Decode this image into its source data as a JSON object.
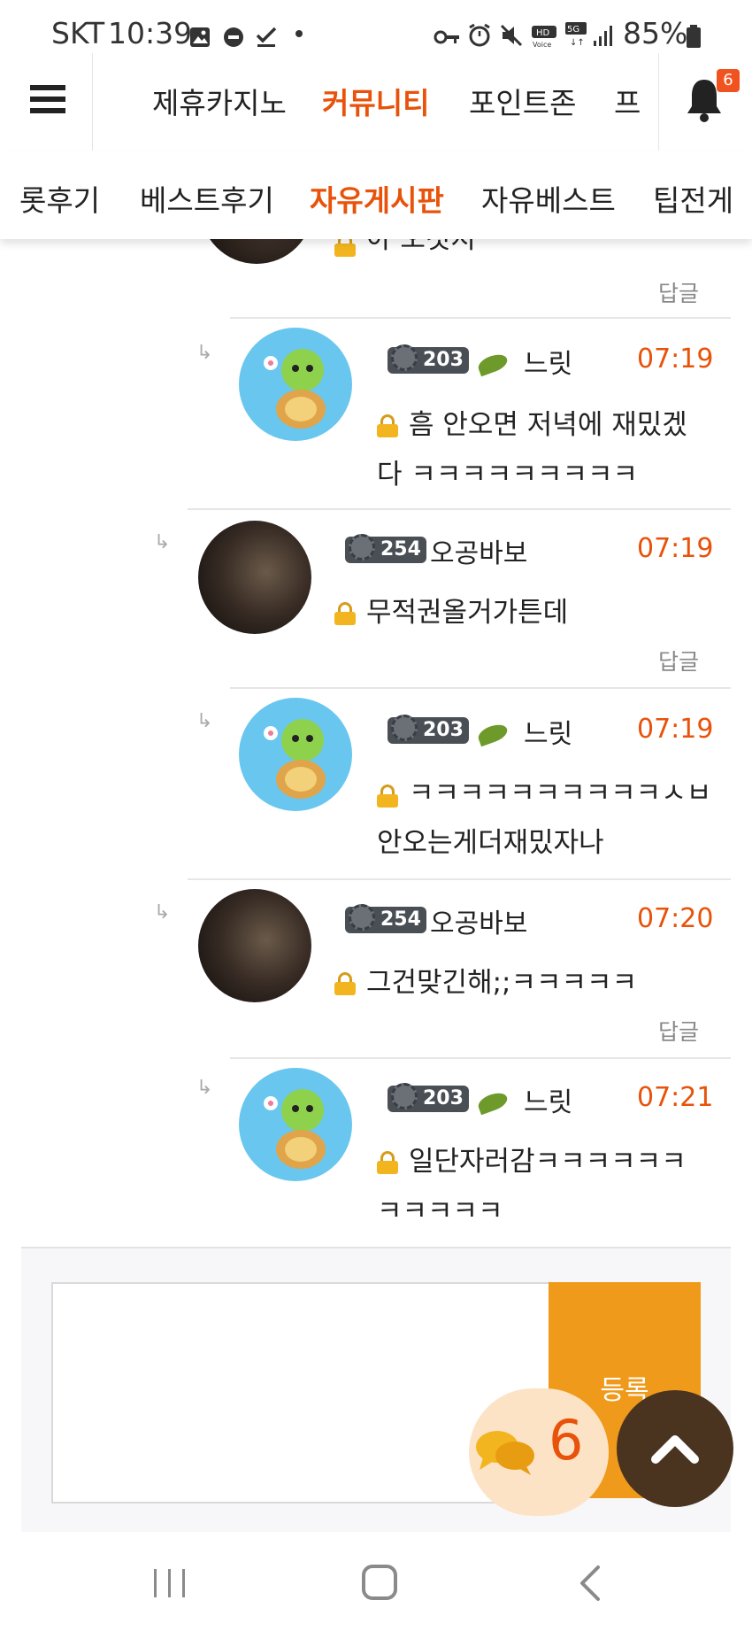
{
  "status_bar": {
    "carrier": "SKT",
    "time": "10:39",
    "battery": "85%"
  },
  "top_nav": {
    "items": [
      "제휴카지노",
      "커뮤니티",
      "포인트존",
      "프"
    ],
    "active": "커뮤니티",
    "notification_count": "6"
  },
  "sub_nav": {
    "items": [
      "롯후기",
      "베스트후기",
      "자유게시판",
      "자유베스트",
      "팁전게"
    ],
    "active": "자유게시판"
  },
  "partial_top_comment": {
    "text": "아 오것지",
    "reply_label": "답글"
  },
  "comments": [
    {
      "user": "느릿",
      "level": "203",
      "time": "07:19",
      "line1": "흠 안오면 저녁에 재밌겠",
      "line2": "다 ㅋㅋㅋㅋㅋㅋㅋㅋㅋ",
      "reply": ""
    },
    {
      "user": "오공바보",
      "level": "254",
      "time": "07:19",
      "line1": "무적권올거가튼데",
      "line2": "",
      "reply": "답글"
    },
    {
      "user": "느릿",
      "level": "203",
      "time": "07:19",
      "line1": "ㅋㅋㅋㅋㅋㅋㅋㅋㅋㅋㅅㅂ",
      "line2": "안오는게더재밌자나",
      "reply": ""
    },
    {
      "user": "오공바보",
      "level": "254",
      "time": "07:20",
      "line1": "그건맞긴해;;ㅋㅋㅋㅋㅋ",
      "line2": "",
      "reply": "답글"
    },
    {
      "user": "느릿",
      "level": "203",
      "time": "07:21",
      "line1": "일단자러감ㅋㅋㅋㅋㅋㅋ",
      "line2": "ㅋㅋㅋㅋㅋ",
      "reply": ""
    }
  ],
  "compose": {
    "submit_label": "등록",
    "chat_count": "6"
  },
  "colors": {
    "accent": "#e8520a",
    "button": "#f09a1c",
    "scroll_top": "#4a3420"
  },
  "icons": [
    "menu-icon",
    "bell-icon",
    "image-icon",
    "dnd-icon",
    "check-icon",
    "key-icon",
    "alarm-icon",
    "mute-icon",
    "signal-icon",
    "battery-icon",
    "lock-icon",
    "reply-arrow-icon",
    "chat-bubbles-icon",
    "chevron-up-icon",
    "recents-icon",
    "home-icon",
    "back-icon"
  ]
}
